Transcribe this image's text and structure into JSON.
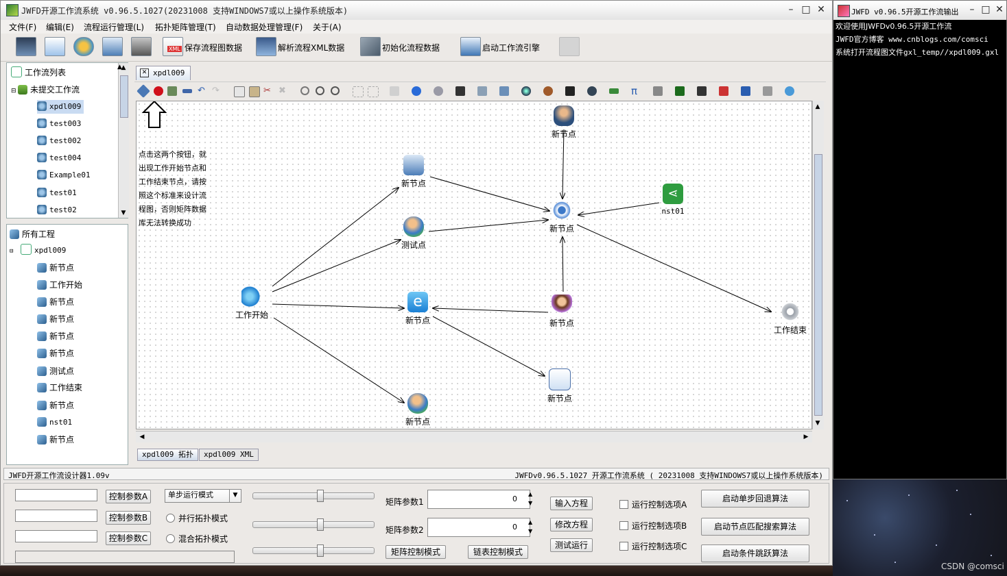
{
  "main_window": {
    "title": "JWFD开源工作流系统 v0.96.5.1027(20231008 支持WINDOWS7或以上操作系统版本)",
    "controls": {
      "minimize": "–",
      "maximize": "□",
      "close": "✕"
    }
  },
  "menu": [
    "文件(F)",
    "编辑(E)",
    "流程运行管理(L)",
    "拓扑矩阵管理(T)",
    "自动数据处理管理(F)",
    "关于(A)"
  ],
  "toolbar": {
    "save_xml": "保存流程图数据",
    "parse_xml": "解析流程XML数据",
    "init_flow": "初始化流程数据",
    "start_engine": "启动工作流引擎",
    "xml_badge": "XML"
  },
  "workflow_list": {
    "title": "工作流列表",
    "group": "未提交工作流",
    "items": [
      "xpdl009",
      "test003",
      "test002",
      "test004",
      "Example01",
      "test01",
      "test02"
    ]
  },
  "projects": {
    "title": "所有工程",
    "root": "xpdl009",
    "items": [
      "新节点",
      "工作开始",
      "新节点",
      "新节点",
      "新节点",
      "新节点",
      "测试点",
      "工作结束",
      "新节点",
      "nst01",
      "新节点"
    ]
  },
  "editor": {
    "tab": "xpdl009",
    "hint_lines": [
      "点击这两个按钮，就",
      "出现工作开始节点和",
      "工作结束节点，请按",
      "照这个标准来设计流",
      "程图，否则矩阵数据",
      "库无法转换成功"
    ],
    "nodes": {
      "top": "新节点",
      "computer": "新节点",
      "test": "测试点",
      "hub": "新节点",
      "share": "nst01",
      "start": "工作开始",
      "web": "新节点",
      "woman": "新节点",
      "end": "工作结束",
      "form": "新节点",
      "bottom": "新节点"
    },
    "bottom_tabs": [
      "xpdl009 拓扑",
      "xpdl009 XML"
    ]
  },
  "status": {
    "left": "JWFD开源工作流设计器1.09v",
    "right": "JWFDv0.96.5.1027 开源工作流系统 ( 20231008 支持WINDOWS7或以上操作系统版本)"
  },
  "control_panel": {
    "param_a": "控制参数A",
    "param_b": "控制参数B",
    "param_c": "控制参数C",
    "run_mode": "单步运行模式",
    "parallel": "并行拓扑模式",
    "mixed": "混合拓扑模式",
    "matrix_param1": "矩阵参数1",
    "matrix_param2": "矩阵参数2",
    "value1": "0",
    "value2": "0",
    "matrix_mode": "矩阵控制模式",
    "list_mode": "链表控制模式",
    "input_eq": "输入方程",
    "edit_eq": "修改方程",
    "test_run": "测试运行",
    "opt_a": "运行控制选项A",
    "opt_b": "运行控制选项B",
    "opt_c": "运行控制选项C",
    "algo1": "启动单步回退算法",
    "algo2": "启动节点匹配搜索算法",
    "algo3": "启动条件跳跃算法",
    "slider_values": [
      0.55,
      0.55,
      0.55
    ]
  },
  "console": {
    "title": "JWFD v0.96.5开源工作流输出",
    "lines": [
      "欢迎使用JWFDv0.96.5开源工作流",
      "JWFD官方博客 www.cnblogs.com/comsci",
      "系统打开流程图文件gxl_temp//xpdl009.gxl"
    ]
  },
  "watermark": "CSDN @comsci"
}
